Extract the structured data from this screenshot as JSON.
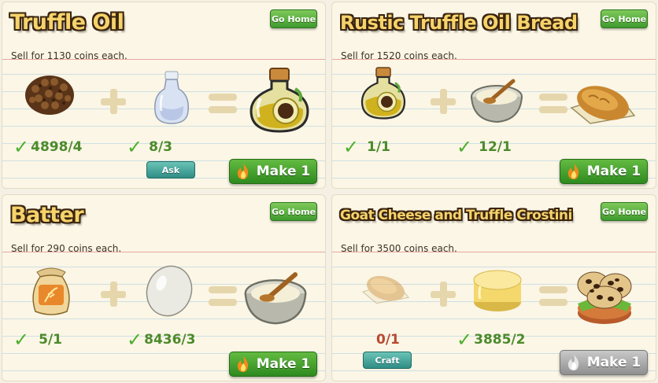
{
  "cards": [
    {
      "title": "Truffle Oil",
      "go_home": "Go Home",
      "sell": "Sell for 1130 coins each.",
      "ingredients": [
        {
          "icon": "truffle-icon",
          "count": "4898/4",
          "satisfied": true
        },
        {
          "icon": "empty-bottle-icon",
          "count": "8/3",
          "satisfied": true,
          "action": "Ask"
        }
      ],
      "result_icon": "truffle-oil-icon",
      "make_label": "Make 1",
      "make_enabled": true
    },
    {
      "title": "Rustic Truffle Oil Bread",
      "go_home": "Go Home",
      "sell": "Sell for 1520 coins each.",
      "ingredients": [
        {
          "icon": "truffle-oil-icon",
          "count": "1/1",
          "satisfied": true
        },
        {
          "icon": "batter-bowl-icon",
          "count": "12/1",
          "satisfied": true
        }
      ],
      "result_icon": "bread-icon",
      "make_label": "Make 1",
      "make_enabled": true
    },
    {
      "title": "Batter",
      "go_home": "Go Home",
      "sell": "Sell for 290 coins each.",
      "ingredients": [
        {
          "icon": "flour-sack-icon",
          "count": "5/1",
          "satisfied": true
        },
        {
          "icon": "egg-icon",
          "count": "8436/3",
          "satisfied": true
        }
      ],
      "result_icon": "batter-bowl-icon",
      "make_label": "Make 1",
      "make_enabled": true
    },
    {
      "title": "Goat Cheese and Truffle Crostini",
      "go_home": "Go Home",
      "sell": "Sell for 3500 coins each.",
      "ingredients": [
        {
          "icon": "bread-icon",
          "count": "0/1",
          "satisfied": false,
          "action": "Craft"
        },
        {
          "icon": "goat-cheese-icon",
          "count": "3885/2",
          "satisfied": true
        }
      ],
      "result_icon": "crostini-icon",
      "make_label": "Make 1",
      "make_enabled": false
    }
  ],
  "colors": {
    "title_fill": "#f6d36b",
    "title_outline": "#3a2410",
    "make_green": "#3f9a2e",
    "ask_teal": "#2f8d86",
    "count_green": "#4c8a2b",
    "count_red": "#b84a32"
  }
}
